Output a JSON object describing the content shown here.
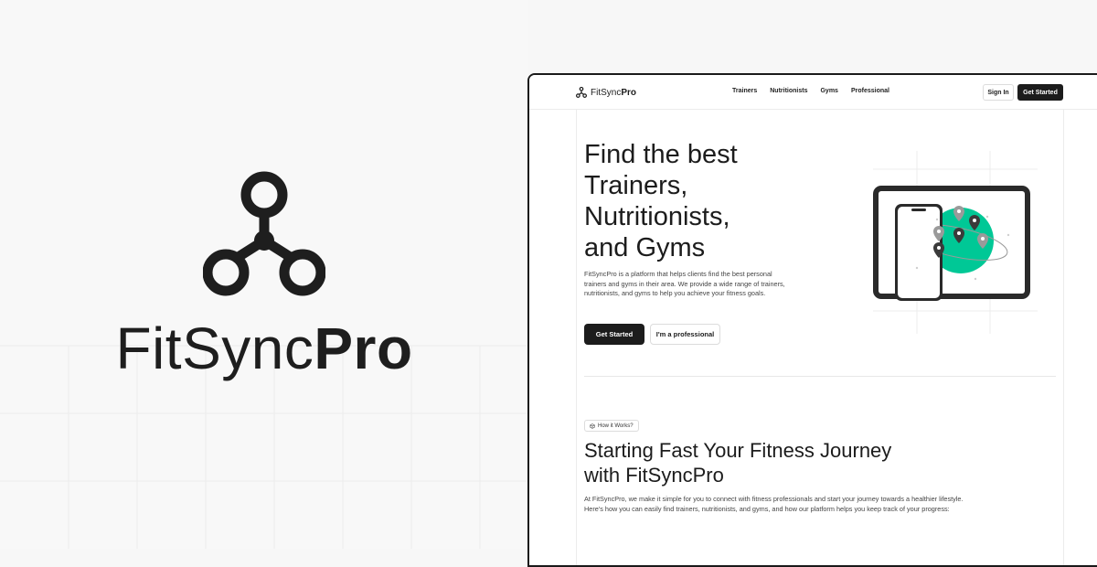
{
  "brand": {
    "name_light": "FitSync",
    "name_bold": "Pro",
    "logo_icon": "three-node-link-icon",
    "colors": {
      "dark": "#1e1e1e",
      "accent": "#00c896",
      "background": "#f8f8f8"
    }
  },
  "site": {
    "logo_light": "FitSync",
    "logo_bold": "Pro",
    "nav": [
      "Trainers",
      "Nutritionists",
      "Gyms",
      "Professional"
    ],
    "sign_in": "Sign In",
    "get_started": "Get Started"
  },
  "hero": {
    "title_lines": [
      "Find the best",
      "Trainers,",
      "Nutritionists,",
      "and Gyms"
    ],
    "description": "FitSyncPro is a platform that helps clients find the best personal trainers and gyms in their area. We provide a wide range of trainers, nutritionists, and gyms to help you achieve your fitness goals.",
    "primary_button": "Get Started",
    "secondary_button": "I'm a professional",
    "illustration_icon": "devices-map-pins-icon"
  },
  "how_it_works": {
    "badge": "How it Works?",
    "title_lines": [
      "Starting Fast Your Fitness Journey",
      "with FitSyncPro"
    ],
    "description": "At FitSyncPro, we make it simple for you to connect with fitness professionals and start your journey towards a healthier lifestyle. Here's how you can easily find trainers, nutritionists, and gyms, and how our platform helps you keep track of your progress:"
  }
}
